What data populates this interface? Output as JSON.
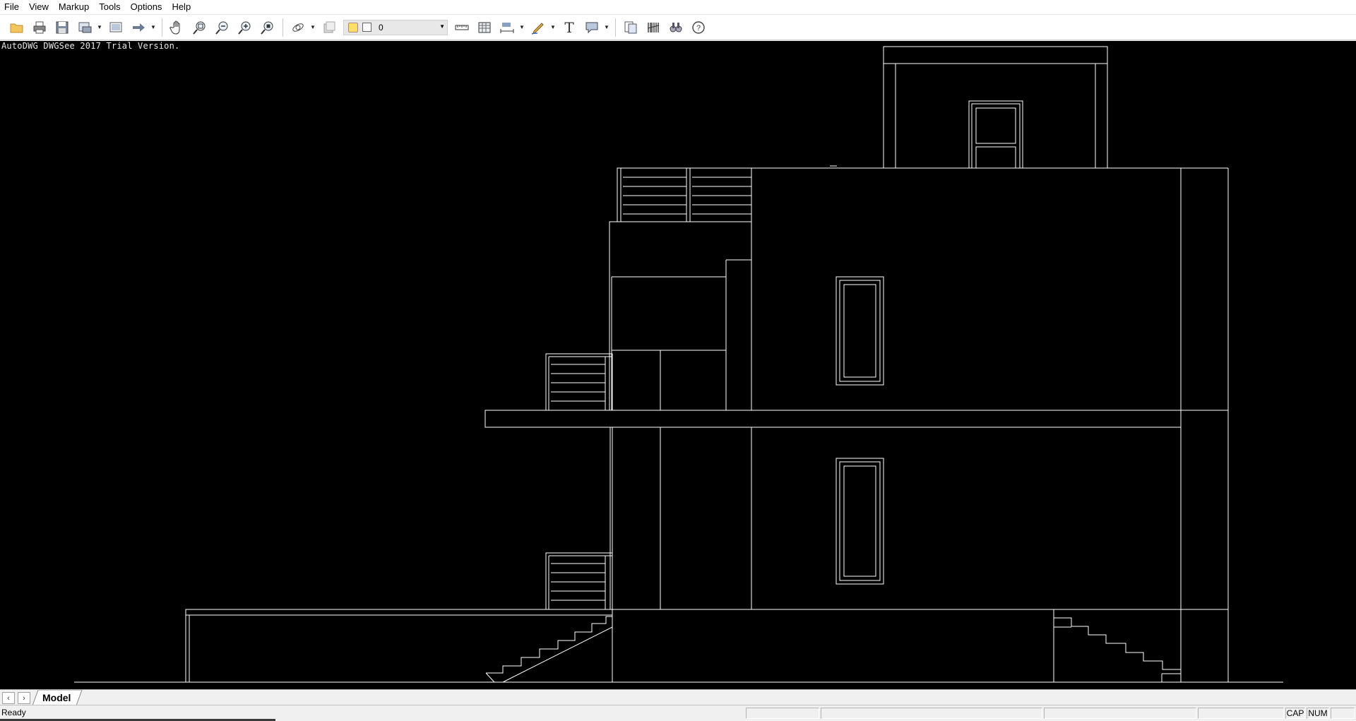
{
  "menubar": {
    "items": [
      "File",
      "View",
      "Markup",
      "Tools",
      "Options",
      "Help"
    ]
  },
  "toolbar": {
    "layer_value": "0",
    "icons": [
      "open-icon",
      "print-icon",
      "save-icon",
      "export-icon",
      "layout-icon",
      "arrow-right-icon",
      "pan-hand-icon",
      "zoom-window-icon",
      "zoom-out-icon",
      "zoom-in-icon",
      "zoom-extents-icon",
      "orbit-icon",
      "layer-states-icon",
      "measure-distance-icon",
      "measure-area-icon",
      "dimension-icon",
      "pen-markup-icon",
      "text-icon",
      "callout-icon",
      "compare-icon",
      "barcode-icon",
      "find-icon",
      "help-icon"
    ]
  },
  "canvas": {
    "watermark": "AutoDWG DWGSee 2017 Trial Version.",
    "background": "#000000",
    "line_color": "#ffffff"
  },
  "tabs": {
    "active": "Model",
    "prev_label": "‹",
    "next_label": "›"
  },
  "statusbar": {
    "text": "Ready",
    "cap": "CAP",
    "num": "NUM"
  }
}
